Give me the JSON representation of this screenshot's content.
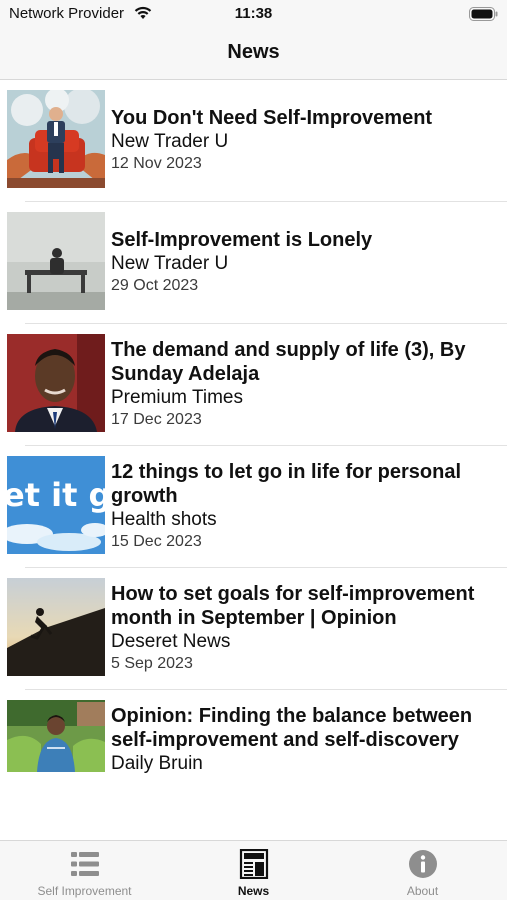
{
  "status_bar": {
    "carrier": "Network Provider",
    "time": "11:38"
  },
  "nav": {
    "title": "News"
  },
  "news": [
    {
      "title": "You Don't Need Self-Improvement",
      "source": "New Trader U",
      "date": "12 Nov 2023",
      "thumbnail": "man-in-red-armchair"
    },
    {
      "title": "Self-Improvement is Lonely",
      "source": "New Trader U",
      "date": "29 Oct 2023",
      "thumbnail": "person-on-bench-in-fog"
    },
    {
      "title": "The demand and supply of life (3), By Sunday Adelaja",
      "source": "Premium Times",
      "date": "17 Dec 2023",
      "thumbnail": "man-portrait"
    },
    {
      "title": "12 things to let go in life for personal growth",
      "source": "Health shots",
      "date": "15 Dec 2023",
      "thumbnail": "let-it-go-clouds",
      "thumb_text": "et it g"
    },
    {
      "title": "How to set goals for self-improvement month in September | Opinion",
      "source": "Deseret News",
      "date": "5 Sep 2023",
      "thumbnail": "climber-silhouette"
    },
    {
      "title": "Opinion: Finding the balance between self-improvement and self-discovery",
      "source": "Daily Bruin",
      "date": "",
      "thumbnail": "student-outdoors"
    }
  ],
  "tabs": [
    {
      "label": "Self Improvement",
      "icon": "list-icon",
      "active": false
    },
    {
      "label": "News",
      "icon": "newspaper-icon",
      "active": true
    },
    {
      "label": "About",
      "icon": "info-icon",
      "active": false
    }
  ],
  "colors": {
    "active_tab": "#111111",
    "inactive_tab": "#8e8e8e",
    "bar_background": "#f7f7f7"
  }
}
